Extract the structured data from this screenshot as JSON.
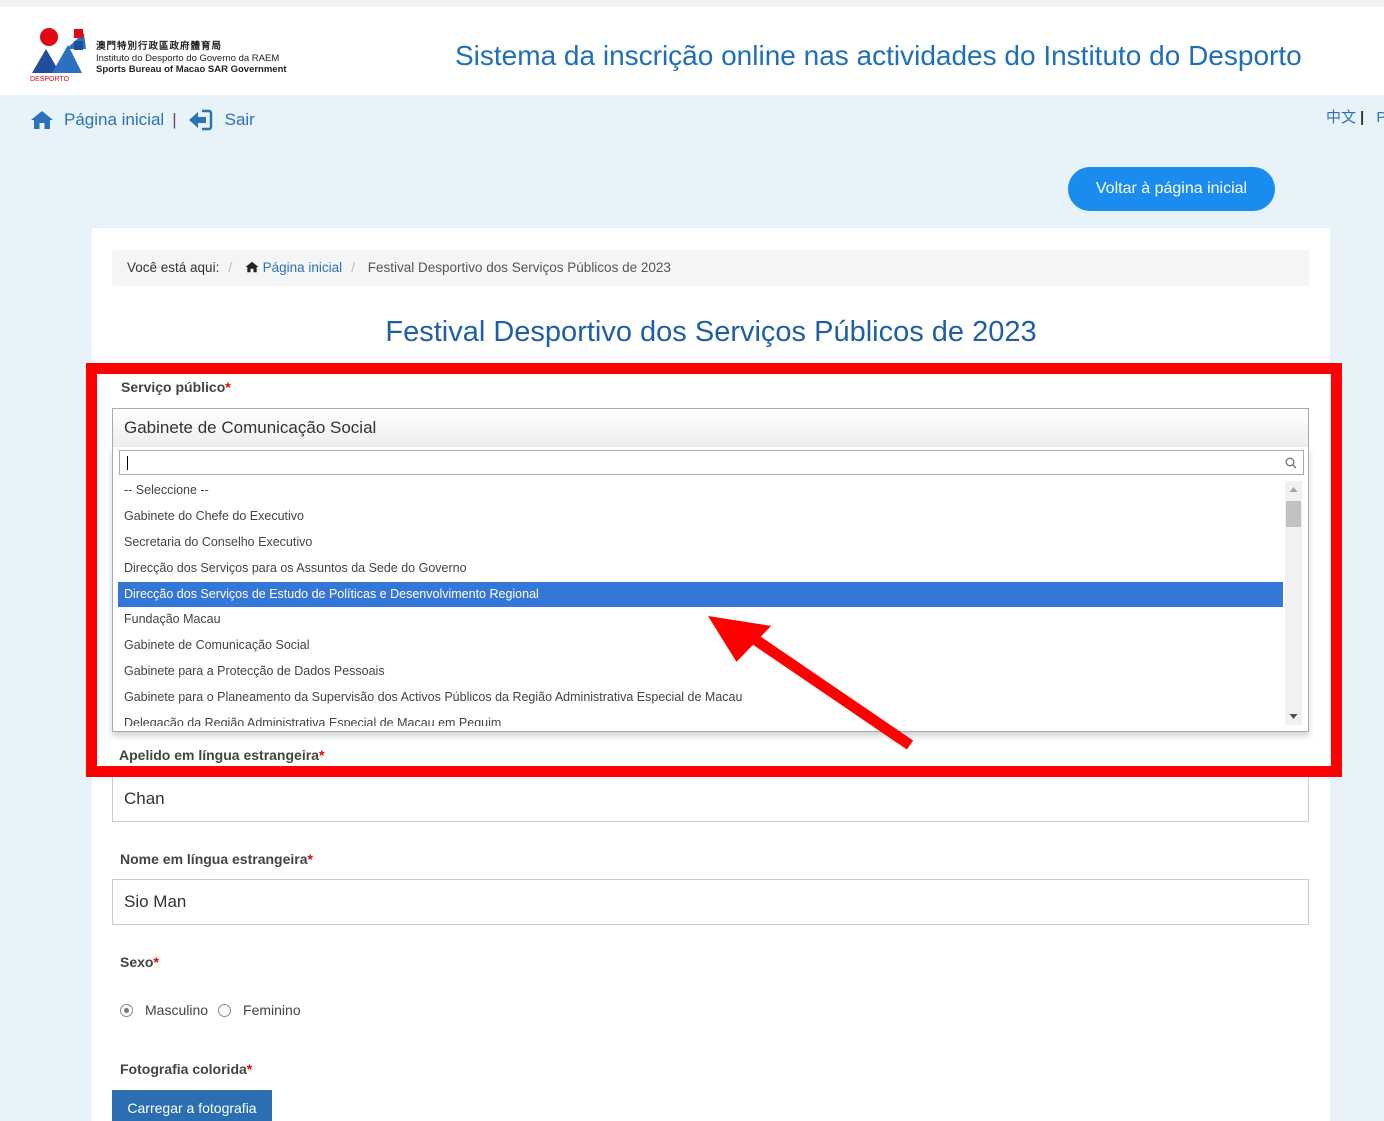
{
  "header": {
    "logo_zh": "澳門特別行政區政府體育局",
    "logo_pt": "Instituto do Desporto do Governo da RAEM",
    "logo_en": "Sports Bureau of Macao SAR Government",
    "logo_mark": "DESPORTO",
    "site_title": "Sistema da inscrição online nas actividades do Instituto do Desporto"
  },
  "topnav": {
    "home_label": "Página inicial",
    "separator": "|",
    "logout_label": "Sair",
    "lang_zh": "中文",
    "lang_separator": "|",
    "lang_next": "P"
  },
  "back_button": "Voltar à página inicial",
  "breadcrumb": {
    "prefix": "Você está aqui:",
    "divider": "/",
    "home": "Página inicial",
    "current": "Festival Desportivo dos Serviços Públicos de 2023"
  },
  "page_title": "Festival Desportivo dos Serviços Públicos de 2023",
  "form": {
    "required_mark": "*",
    "service": {
      "label": "Serviço público",
      "selected": "Gabinete de Comunicação Social",
      "search_value": "",
      "options": [
        "-- Seleccione --",
        "Gabinete do Chefe do Executivo",
        "Secretaria do Conselho Executivo",
        "Direcção dos Serviços para os Assuntos da Sede do Governo",
        "Direcção dos Serviços de Estudo de Políticas e Desenvolvimento Regional",
        "Fundação Macau",
        "Gabinete de Comunicação Social",
        "Gabinete para a Protecção de Dados Pessoais",
        "Gabinete para o Planeamento da Supervisão dos Activos Públicos da Região Administrativa Especial de Macau",
        "Delegação da Região Administrativa Especial de Macau em Pequim"
      ],
      "highlighted_index": 4
    },
    "surname": {
      "label": "Apelido em língua estrangeira",
      "value": "Chan"
    },
    "given_name": {
      "label": "Nome em língua estrangeira",
      "value": "Sio Man"
    },
    "sex": {
      "label": "Sexo",
      "options": [
        "Masculino",
        "Feminino"
      ],
      "selected": "Masculino"
    },
    "photo": {
      "label": "Fotografia colorida",
      "button": "Carregar a fotografia"
    }
  },
  "colors": {
    "title_blue": "#1d6fb8",
    "band": "#e7f2f9",
    "back_button": "#1a8cf0",
    "highlight_option": "#3477d8",
    "annotation_red": "#ff0000"
  },
  "icons": [
    "home-icon",
    "logout-icon",
    "search-icon",
    "scroll-up-icon",
    "scroll-down-icon",
    "radio-icon"
  ]
}
